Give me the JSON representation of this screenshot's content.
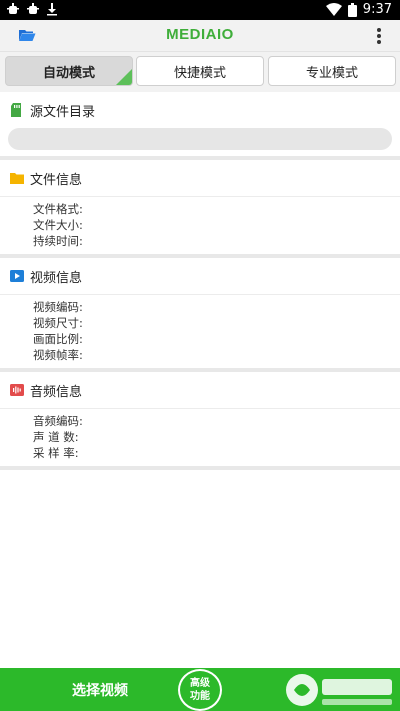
{
  "status_bar": {
    "time": "9:37"
  },
  "app": {
    "title": "MEDIAIO"
  },
  "tabs": [
    {
      "label": "自动模式",
      "active": true
    },
    {
      "label": "快捷模式",
      "active": false
    },
    {
      "label": "专业模式",
      "active": false
    }
  ],
  "source": {
    "title": "源文件目录",
    "path": ""
  },
  "file_info": {
    "title": "文件信息",
    "rows": [
      "文件格式:",
      "文件大小:",
      "持续时间:"
    ]
  },
  "video_info": {
    "title": "视频信息",
    "rows": [
      "视频编码:",
      "视频尺寸:",
      "画面比例:",
      "视频帧率:"
    ]
  },
  "audio_info": {
    "title": "音频信息",
    "rows": [
      "音频编码:",
      "声 道 数:",
      "采 样 率:"
    ]
  },
  "bottom": {
    "select_video": "选择视频",
    "advanced_line1": "高级",
    "advanced_line2": "功能"
  },
  "colors": {
    "brand": "#3fae3a",
    "bottom_bar": "#2cb92a"
  }
}
